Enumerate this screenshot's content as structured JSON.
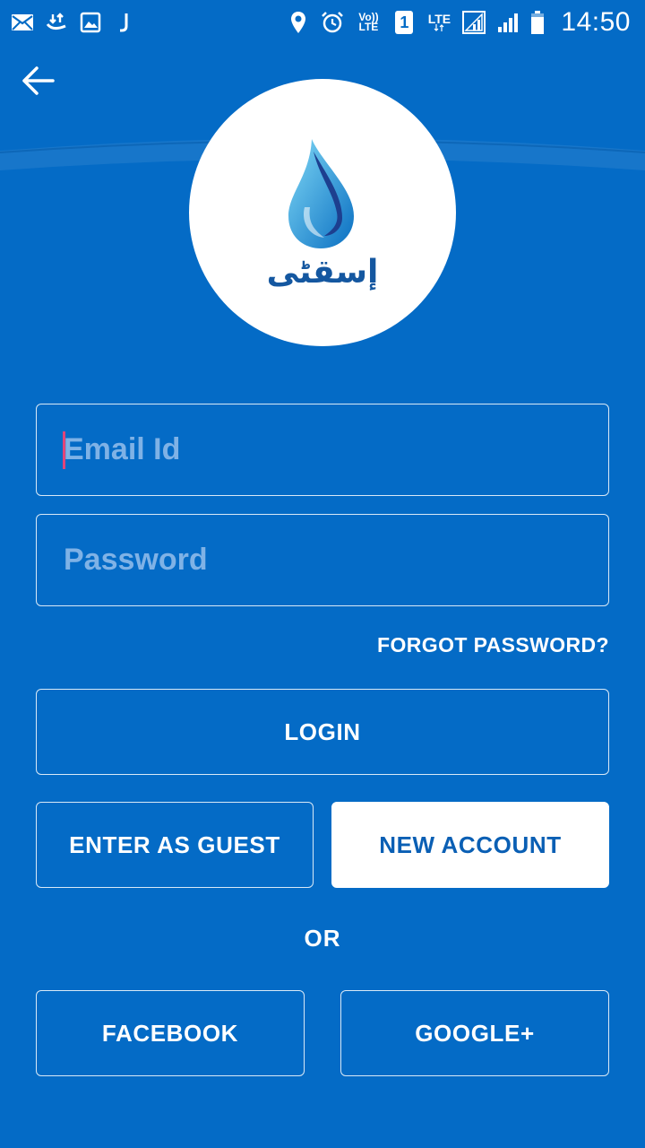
{
  "status_bar": {
    "time": "14:50",
    "volte_label": "Vo)) LTE",
    "sim_label": "1",
    "lte_label": "LTE",
    "left_icons": [
      "mail-icon",
      "download-icon",
      "image-icon",
      "j-icon"
    ],
    "right_icons": [
      "location-icon",
      "alarm-icon",
      "volte-icon",
      "sim-icon",
      "lte-icon",
      "signal-r-icon",
      "signal-icon",
      "battery-icon"
    ]
  },
  "header": {
    "back_icon": "arrow-left-icon",
    "logo_text": "إسقٹی"
  },
  "form": {
    "email_placeholder": "Email Id",
    "password_placeholder": "Password",
    "forgot_label": "FORGOT PASSWORD?"
  },
  "actions": {
    "login_label": "LOGIN",
    "guest_label": "ENTER AS GUEST",
    "new_account_label": "NEW ACCOUNT",
    "or_label": "OR",
    "facebook_label": "FACEBOOK",
    "google_label": "GOOGLE+"
  },
  "colors": {
    "background": "#046bc6",
    "caret": "#e0457b",
    "placeholder": "#7fb2e6",
    "new_account_text": "#0a5fb4"
  }
}
